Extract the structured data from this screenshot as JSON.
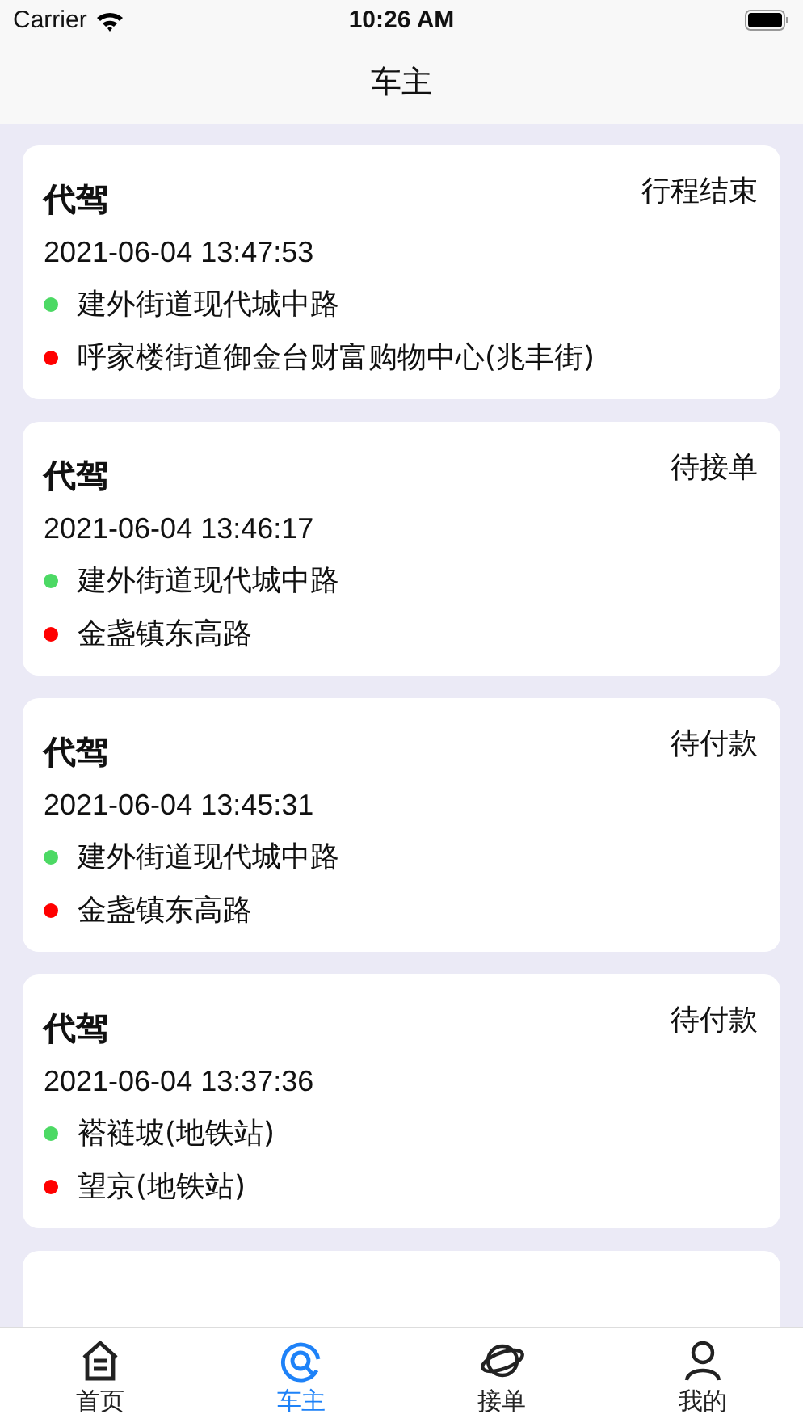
{
  "status_bar": {
    "carrier": "Carrier",
    "time": "10:26 AM"
  },
  "nav_bar": {
    "title": "车主"
  },
  "orders": [
    {
      "type": "代驾",
      "status": "行程结束",
      "time": "2021-06-04 13:47:53",
      "stops": [
        {
          "name": "建外街道现代城中路",
          "color": "#4cd964"
        },
        {
          "name": "呼家楼街道御金台财富购物中心(兆丰街)",
          "color": "#ff0000"
        }
      ]
    },
    {
      "type": "代驾",
      "status": "待接单",
      "time": "2021-06-04 13:46:17",
      "stops": [
        {
          "name": "建外街道现代城中路",
          "color": "#4cd964"
        },
        {
          "name": "金盏镇东高路",
          "color": "#ff0000"
        }
      ]
    },
    {
      "type": "代驾",
      "status": "待付款",
      "time": "2021-06-04 13:45:31",
      "stops": [
        {
          "name": "建外街道现代城中路",
          "color": "#4cd964"
        },
        {
          "name": "金盏镇东高路",
          "color": "#ff0000"
        }
      ]
    },
    {
      "type": "代驾",
      "status": "待付款",
      "time": "2021-06-04 13:37:36",
      "stops": [
        {
          "name": "褡裢坡(地铁站)",
          "color": "#4cd964"
        },
        {
          "name": "望京(地铁站)",
          "color": "#ff0000"
        }
      ]
    },
    {
      "kind": "partial"
    }
  ],
  "tab_bar": [
    {
      "label": "首页",
      "kind": "home",
      "selected": false
    },
    {
      "label": "车主",
      "kind": "driver",
      "selected": true
    },
    {
      "label": "接单",
      "kind": "planet",
      "selected": false
    },
    {
      "label": "我的",
      "kind": "person",
      "selected": false
    }
  ]
}
